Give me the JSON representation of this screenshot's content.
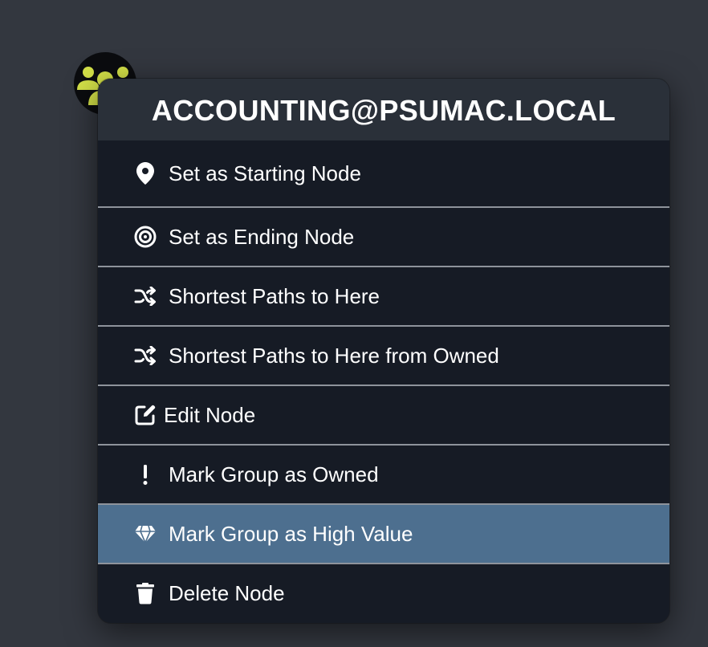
{
  "node": {
    "icon": "group-icon",
    "icon_color": "#d3e048"
  },
  "menu": {
    "title": "ACCOUNTING@PSUMAC.LOCAL",
    "highlight_color": "#4d6f8f",
    "items": [
      {
        "label": "Set as Starting Node",
        "icon": "map-marker-icon"
      },
      {
        "label": "Set as Ending Node",
        "icon": "target-icon"
      },
      {
        "label": "Shortest Paths to Here",
        "icon": "shuffle-icon"
      },
      {
        "label": "Shortest Paths to Here from Owned",
        "icon": "shuffle-icon"
      },
      {
        "label": "Edit Node",
        "icon": "edit-icon"
      },
      {
        "label": "Mark Group as Owned",
        "icon": "exclamation-icon"
      },
      {
        "label": "Mark Group as High Value",
        "icon": "gem-icon",
        "highlighted": true
      },
      {
        "label": "Delete Node",
        "icon": "trash-icon"
      }
    ]
  }
}
